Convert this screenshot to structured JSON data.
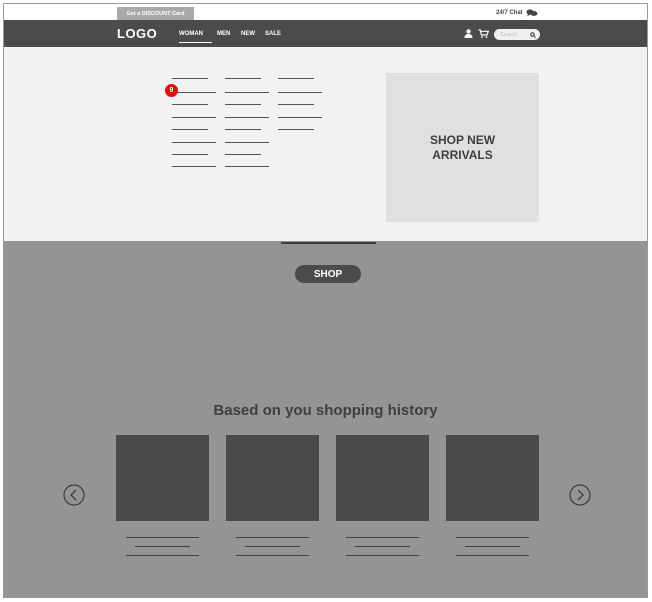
{
  "top_strip": {
    "discount_label": "Get a DISCOUNT Card",
    "chat_label": "24/7 Chat",
    "chat_icon": "chat-bubbles-icon"
  },
  "navbar": {
    "logo": "LOGO",
    "items": [
      "WOMAN",
      "MEN",
      "NEW",
      "SALE"
    ],
    "active_item": "WOMAN",
    "user_icon": "user-icon",
    "cart_icon": "cart-icon",
    "search": {
      "placeholder": "Search",
      "icon": "search-icon"
    }
  },
  "mega_menu": {
    "badge_count": "9",
    "promo_label": "SHOP NEW ARRIVALS"
  },
  "main": {
    "shop_button_label": "SHOP",
    "section_title": "Based on you shopping history",
    "prev_icon": "chevron-left-icon",
    "next_icon": "chevron-right-icon"
  },
  "colors": {
    "navbar": "#4b4b4b",
    "menu_panel": "#f2f2f2",
    "main_background": "#949494",
    "badge": "#e00d0d",
    "card": "#4a4a4a"
  }
}
